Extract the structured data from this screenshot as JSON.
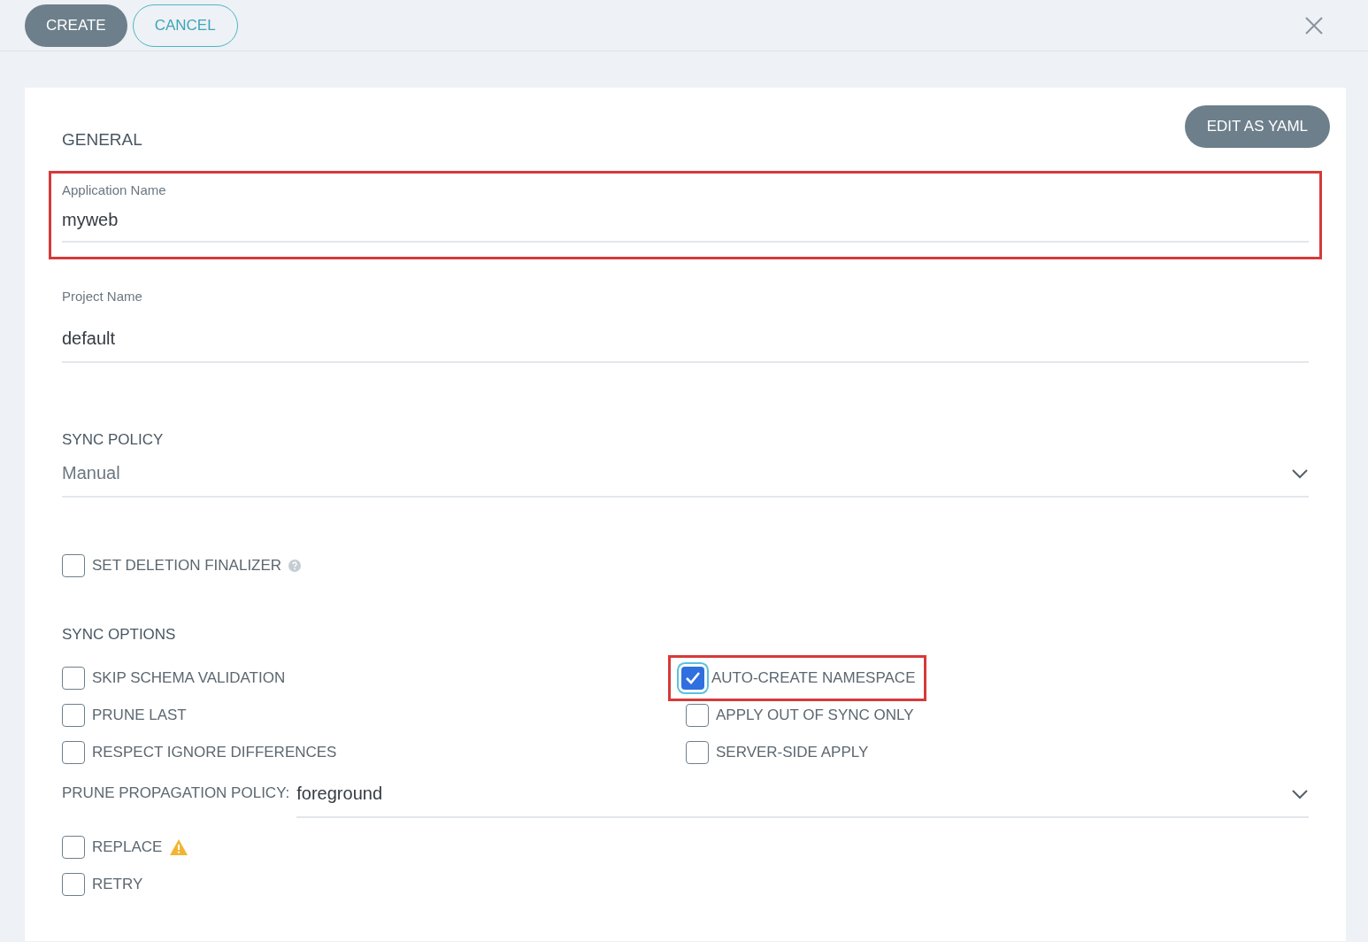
{
  "header": {
    "buttons": [
      {
        "label": "CREATE",
        "kind": "primary"
      },
      {
        "label": "CANCEL",
        "kind": "outline"
      }
    ]
  },
  "section": {
    "title": "GENERAL",
    "yaml_button": "EDIT AS YAML"
  },
  "fields": [
    {
      "label": "Application Name",
      "value": "myweb",
      "highlighted": true
    },
    {
      "label": "Project Name",
      "value": "default",
      "highlighted": false
    }
  ],
  "sync_policy": {
    "label": "SYNC POLICY",
    "value": "Manual"
  },
  "deletion_finalizer": {
    "label": "SET DELETION FINALIZER",
    "checked": false
  },
  "sync_options": {
    "title": "SYNC OPTIONS",
    "items": [
      {
        "label": "SKIP SCHEMA VALIDATION",
        "checked": false,
        "highlighted": false
      },
      {
        "label": "PRUNE LAST",
        "checked": false,
        "highlighted": false
      },
      {
        "label": "RESPECT IGNORE DIFFERENCES",
        "checked": false,
        "highlighted": false
      },
      {
        "label": "AUTO-CREATE NAMESPACE",
        "checked": true,
        "highlighted": true
      },
      {
        "label": "APPLY OUT OF SYNC ONLY",
        "checked": false,
        "highlighted": false
      },
      {
        "label": "SERVER-SIDE APPLY",
        "checked": false,
        "highlighted": false
      }
    ]
  },
  "prune_propagation": {
    "label": "PRUNE PROPAGATION POLICY:",
    "value": "foreground"
  },
  "extra_options": [
    {
      "label": "REPLACE",
      "checked": false,
      "warning": true
    },
    {
      "label": "RETRY",
      "checked": false,
      "warning": false
    }
  ]
}
